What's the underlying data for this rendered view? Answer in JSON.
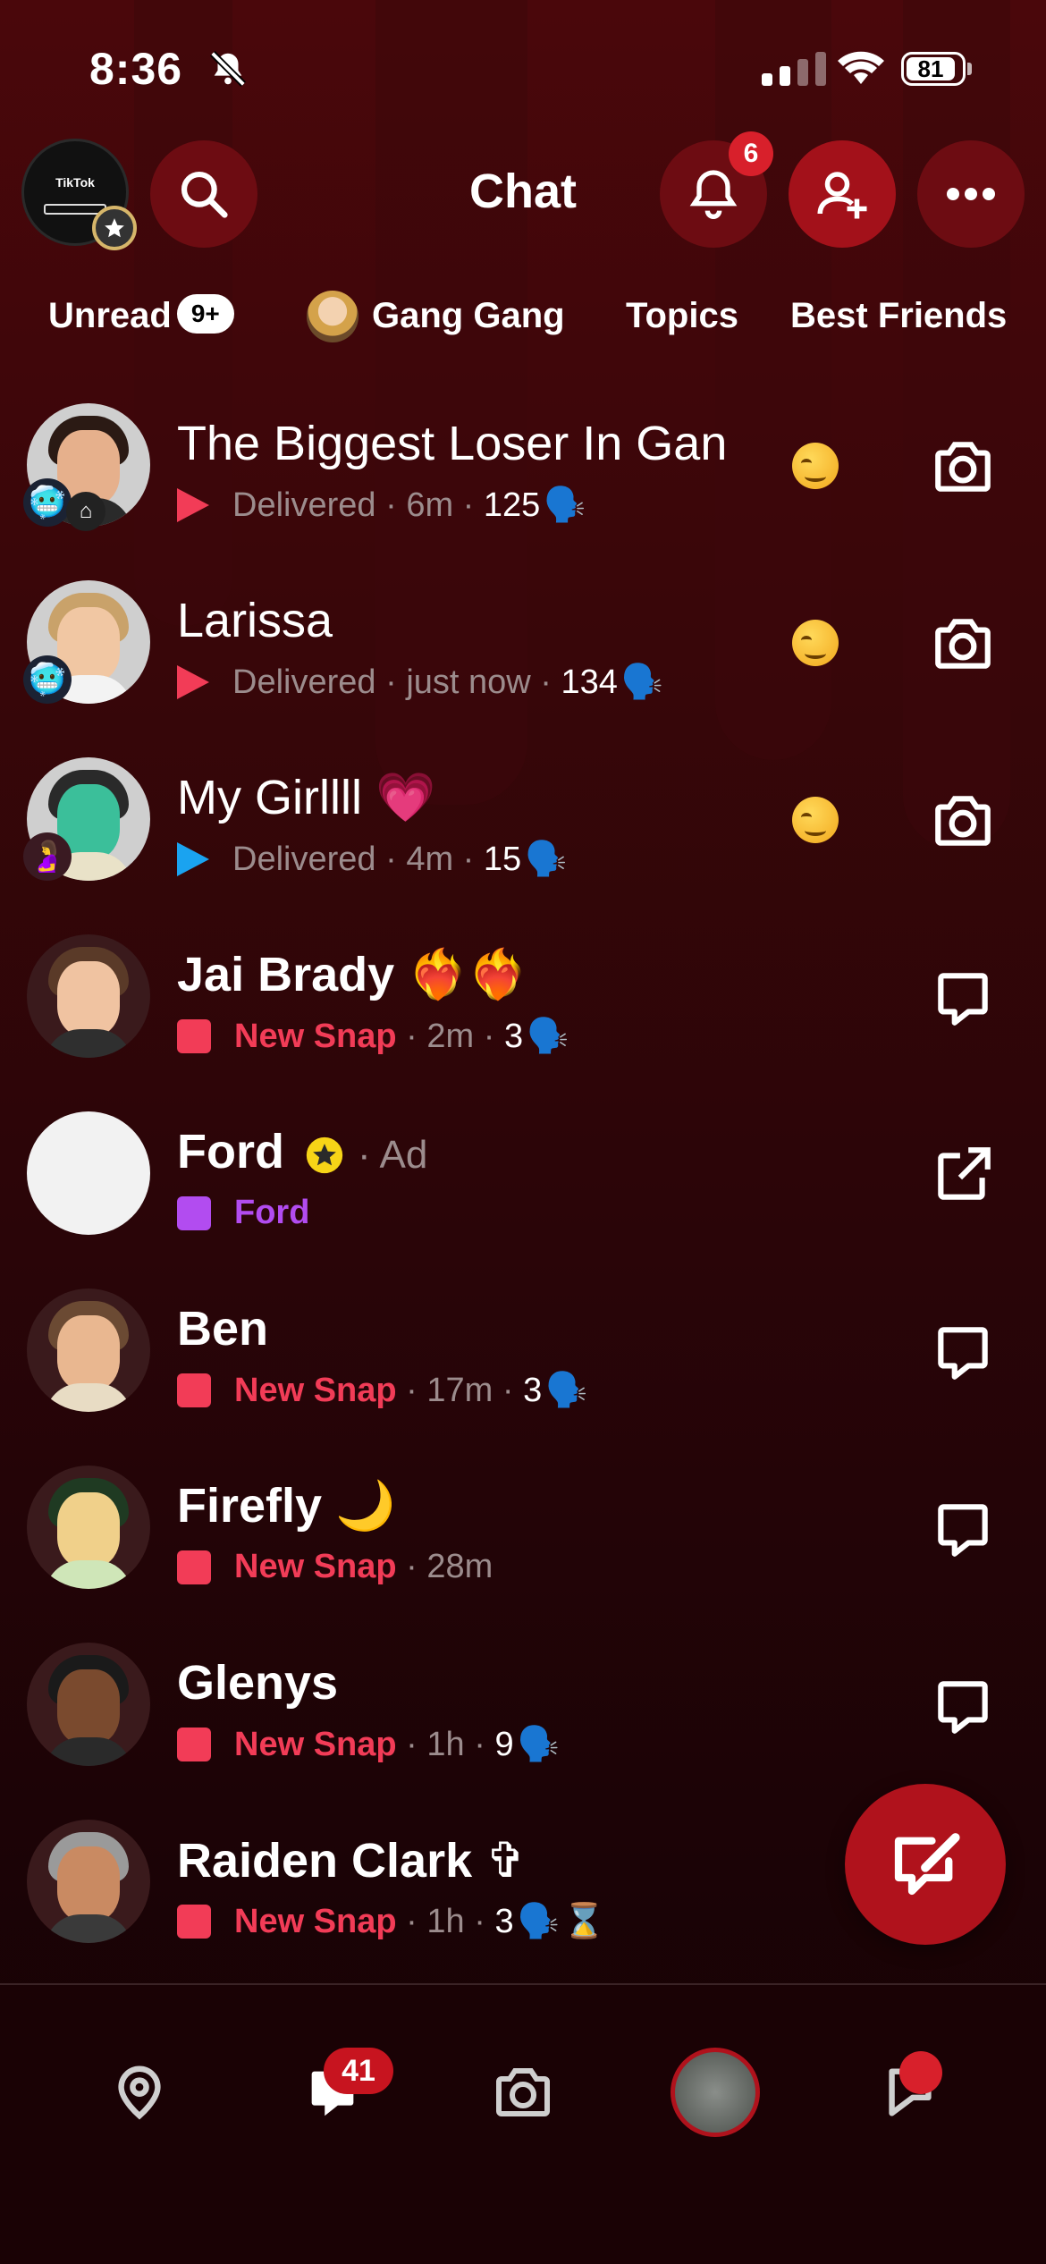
{
  "status_bar": {
    "time": "8:36",
    "battery": "81",
    "signal_bars": 2
  },
  "header": {
    "title": "Chat",
    "notifications_count": "6",
    "profile_label": "TikTok"
  },
  "filters": [
    {
      "label": "Unread",
      "badge": "9+"
    },
    {
      "label": "Gang Gang"
    },
    {
      "label": "Topics"
    },
    {
      "label": "Best Friends"
    }
  ],
  "chats": [
    {
      "name": "The Biggest Loser In Gan",
      "status": "Delivered",
      "status_type": "sent",
      "time": "6m",
      "streak": "125",
      "reaction": "smirk",
      "action": "camera"
    },
    {
      "name": "Larissa",
      "status": "Delivered",
      "status_type": "sent",
      "time": "just now",
      "streak": "134",
      "reaction": "smirk",
      "action": "camera"
    },
    {
      "name": "My Girllll 💗",
      "status": "Delivered",
      "status_type": "sent-chat",
      "time": "4m",
      "streak": "15",
      "reaction": "smirk",
      "action": "camera"
    },
    {
      "name": "Jai Brady ❤️‍🔥❤️‍🔥",
      "status": "New Snap",
      "status_type": "new",
      "time": "2m",
      "streak": "3",
      "action": "chat"
    },
    {
      "name": "Ford",
      "ad_label": "Ad",
      "status": "Ford",
      "status_type": "ad",
      "action": "external"
    },
    {
      "name": "Ben",
      "status": "New Snap",
      "status_type": "new",
      "time": "17m",
      "streak": "3",
      "action": "chat"
    },
    {
      "name": "Firefly 🌙",
      "status": "New Snap",
      "status_type": "new",
      "time": "28m",
      "action": "chat"
    },
    {
      "name": "Glenys",
      "status": "New Snap",
      "status_type": "new",
      "time": "1h",
      "streak": "9",
      "action": "chat"
    },
    {
      "name": "Raiden Clark ✞",
      "status": "New Snap",
      "status_type": "new",
      "time": "1h",
      "streak": "3",
      "hourglass": "⌛",
      "action": "chat"
    }
  ],
  "tabbar": {
    "chat_badge": "41"
  },
  "colors": {
    "new_snap": "#f23c57",
    "sent_arrow": "#f23c57",
    "chat_arrow": "#1aa3f0",
    "ad_purple": "#b24cf0",
    "accent_red": "#b0121c"
  },
  "icons": [
    "search-icon",
    "bell-icon",
    "add-friend-icon",
    "more-icon",
    "camera-icon",
    "chat-bubble-icon",
    "external-link-icon",
    "map-pin-icon",
    "compose-icon",
    "stories-icon"
  ]
}
